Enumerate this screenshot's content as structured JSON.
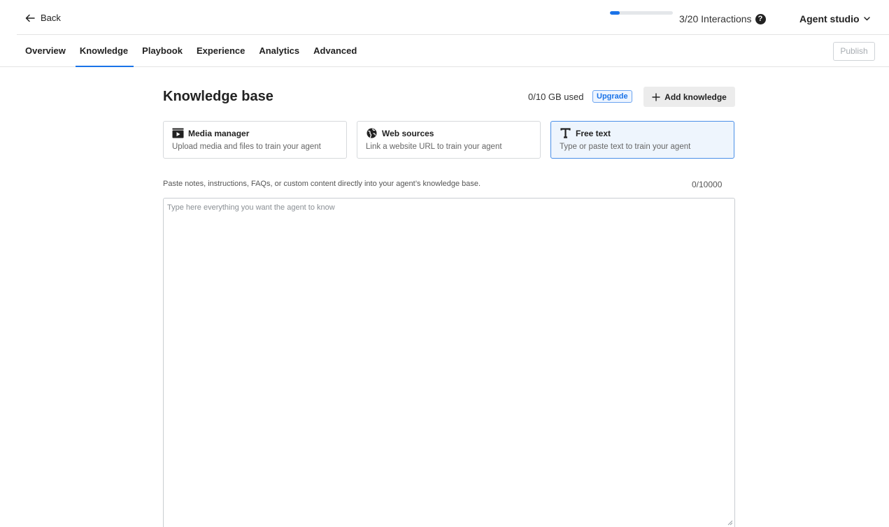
{
  "header": {
    "back_label": "Back",
    "interactions_label": "3/20 Interactions",
    "interactions_progress": 0.15,
    "help_glyph": "?",
    "workspace_label": "Agent studio"
  },
  "nav": {
    "tabs": [
      {
        "label": "Overview"
      },
      {
        "label": "Knowledge"
      },
      {
        "label": "Playbook"
      },
      {
        "label": "Experience"
      },
      {
        "label": "Analytics"
      },
      {
        "label": "Advanced"
      }
    ],
    "active_tab": "Knowledge",
    "publish_label": "Publish"
  },
  "main": {
    "title": "Knowledge base",
    "usage": "0/10 GB used",
    "upgrade_label": "Upgrade",
    "add_knowledge_label": "Add knowledge",
    "sources": [
      {
        "title": "Media manager",
        "description": "Upload media and files to train your agent",
        "icon": "media-icon"
      },
      {
        "title": "Web sources",
        "description": "Link a website URL to train your agent",
        "icon": "globe-icon"
      },
      {
        "title": "Free text",
        "description": "Type or paste text to train your agent",
        "icon": "text-icon"
      }
    ],
    "selected_source": "Free text",
    "hint": "Paste notes, instructions, FAQs, or custom content directly into your agent’s knowledge base.",
    "char_counter": "0/10000",
    "textarea_value": "",
    "textarea_placeholder": "Type here everything you want the agent to know"
  },
  "colors": {
    "accent": "#1a73e8",
    "selected_card_bg": "#eef5fd",
    "button_gray": "#ececec"
  }
}
